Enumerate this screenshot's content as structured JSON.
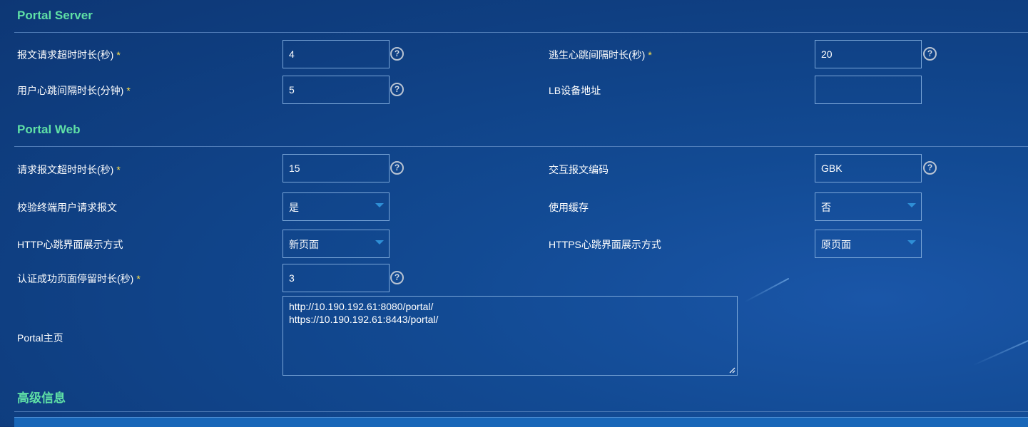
{
  "portal_server": {
    "title": "Portal Server",
    "request_timeout": {
      "label": "报文请求超时时长(秒)",
      "required": "*",
      "value": "4"
    },
    "escape_heartbeat": {
      "label": "逃生心跳间隔时长(秒)",
      "required": "*",
      "value": "20"
    },
    "user_heartbeat": {
      "label": "用户心跳间隔时长(分钟)",
      "required": "*",
      "value": "5"
    },
    "lb_address": {
      "label": "LB设备地址",
      "value": ""
    }
  },
  "portal_web": {
    "title": "Portal Web",
    "request_timeout": {
      "label": "请求报文超时时长(秒)",
      "required": "*",
      "value": "15"
    },
    "encoding": {
      "label": "交互报文编码",
      "value": "GBK"
    },
    "verify_terminal": {
      "label": "校验终端用户请求报文",
      "value": "是"
    },
    "use_cache": {
      "label": "使用缓存",
      "value": "否"
    },
    "http_heartbeat_page": {
      "label": "HTTP心跳界面展示方式",
      "value": "新页面"
    },
    "https_heartbeat_page": {
      "label": "HTTPS心跳界面展示方式",
      "value": "原页面"
    },
    "success_stay": {
      "label": "认证成功页面停留时长(秒)",
      "required": "*",
      "value": "3"
    },
    "homepage": {
      "label": "Portal主页",
      "value": "http://10.190.192.61:8080/portal/\nhttps://10.190.192.61:8443/portal/"
    }
  },
  "advanced": {
    "title": "高级信息"
  },
  "help_glyph": "?",
  "icons": {
    "help": "question-circle-icon",
    "dropdown": "caret-down-icon",
    "resize": "resize-grip-icon"
  },
  "colors": {
    "section_title": "#5fe0a6",
    "required_mark": "#ffe14a",
    "field_border": "#7aa6d8",
    "caret": "#2f8fd6"
  }
}
